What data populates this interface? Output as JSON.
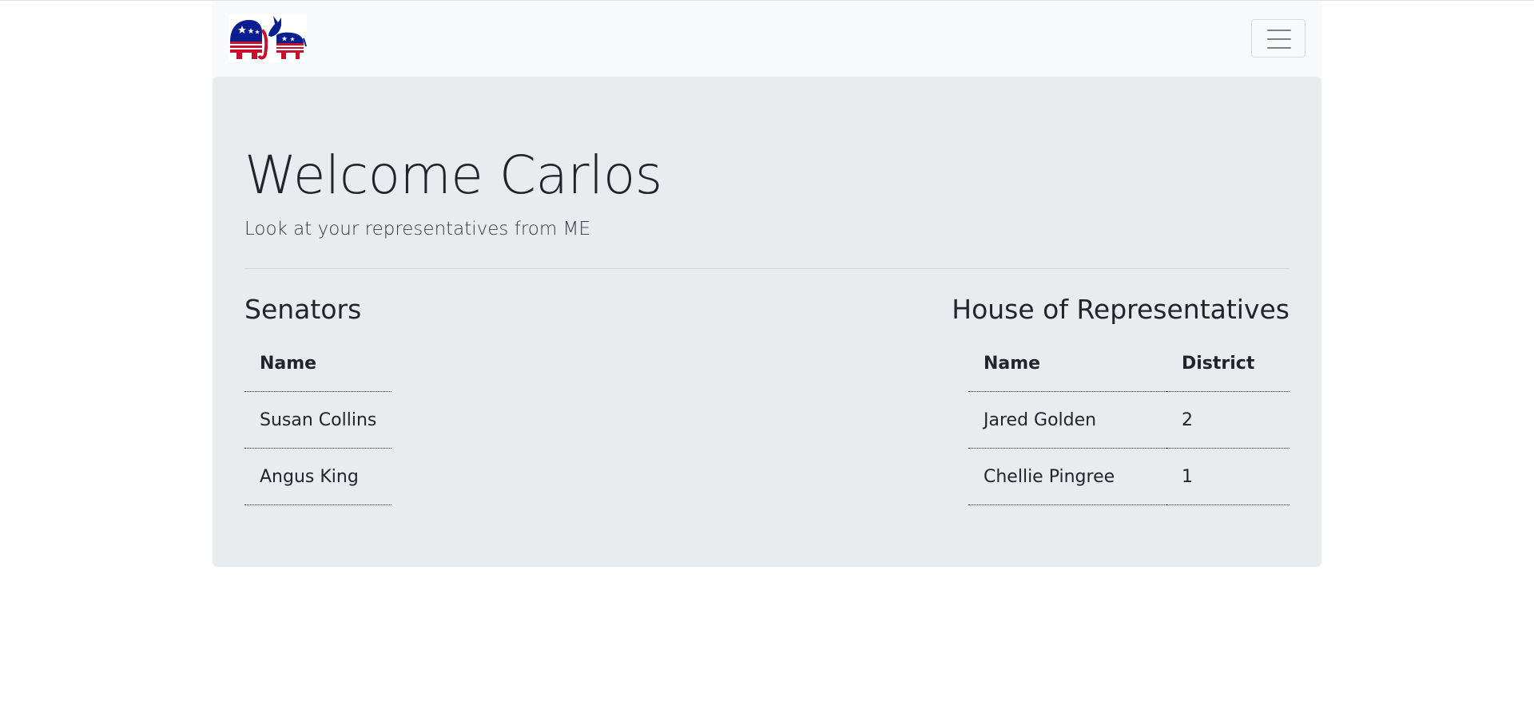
{
  "navbar": {
    "logo_alt": "Republican elephant and Democratic donkey logo",
    "toggler_label": "Toggle navigation"
  },
  "welcome": {
    "title": "Welcome Carlos",
    "subtitle": "Look at your representatives from ME"
  },
  "senators": {
    "title": "Senators",
    "columns": [
      "Name"
    ],
    "rows": [
      {
        "name": "Susan Collins"
      },
      {
        "name": "Angus King"
      }
    ]
  },
  "house": {
    "title": "House of Representatives",
    "columns": [
      "Name",
      "District"
    ],
    "rows": [
      {
        "name": "Jared Golden",
        "district": "2"
      },
      {
        "name": "Chellie Pingree",
        "district": "1"
      }
    ]
  },
  "colors": {
    "navbar_bg": "#f8f9fa",
    "jumbotron_bg": "#e9ecef",
    "republican_red": "#c8102e",
    "democrat_blue": "#0a1f8f"
  }
}
